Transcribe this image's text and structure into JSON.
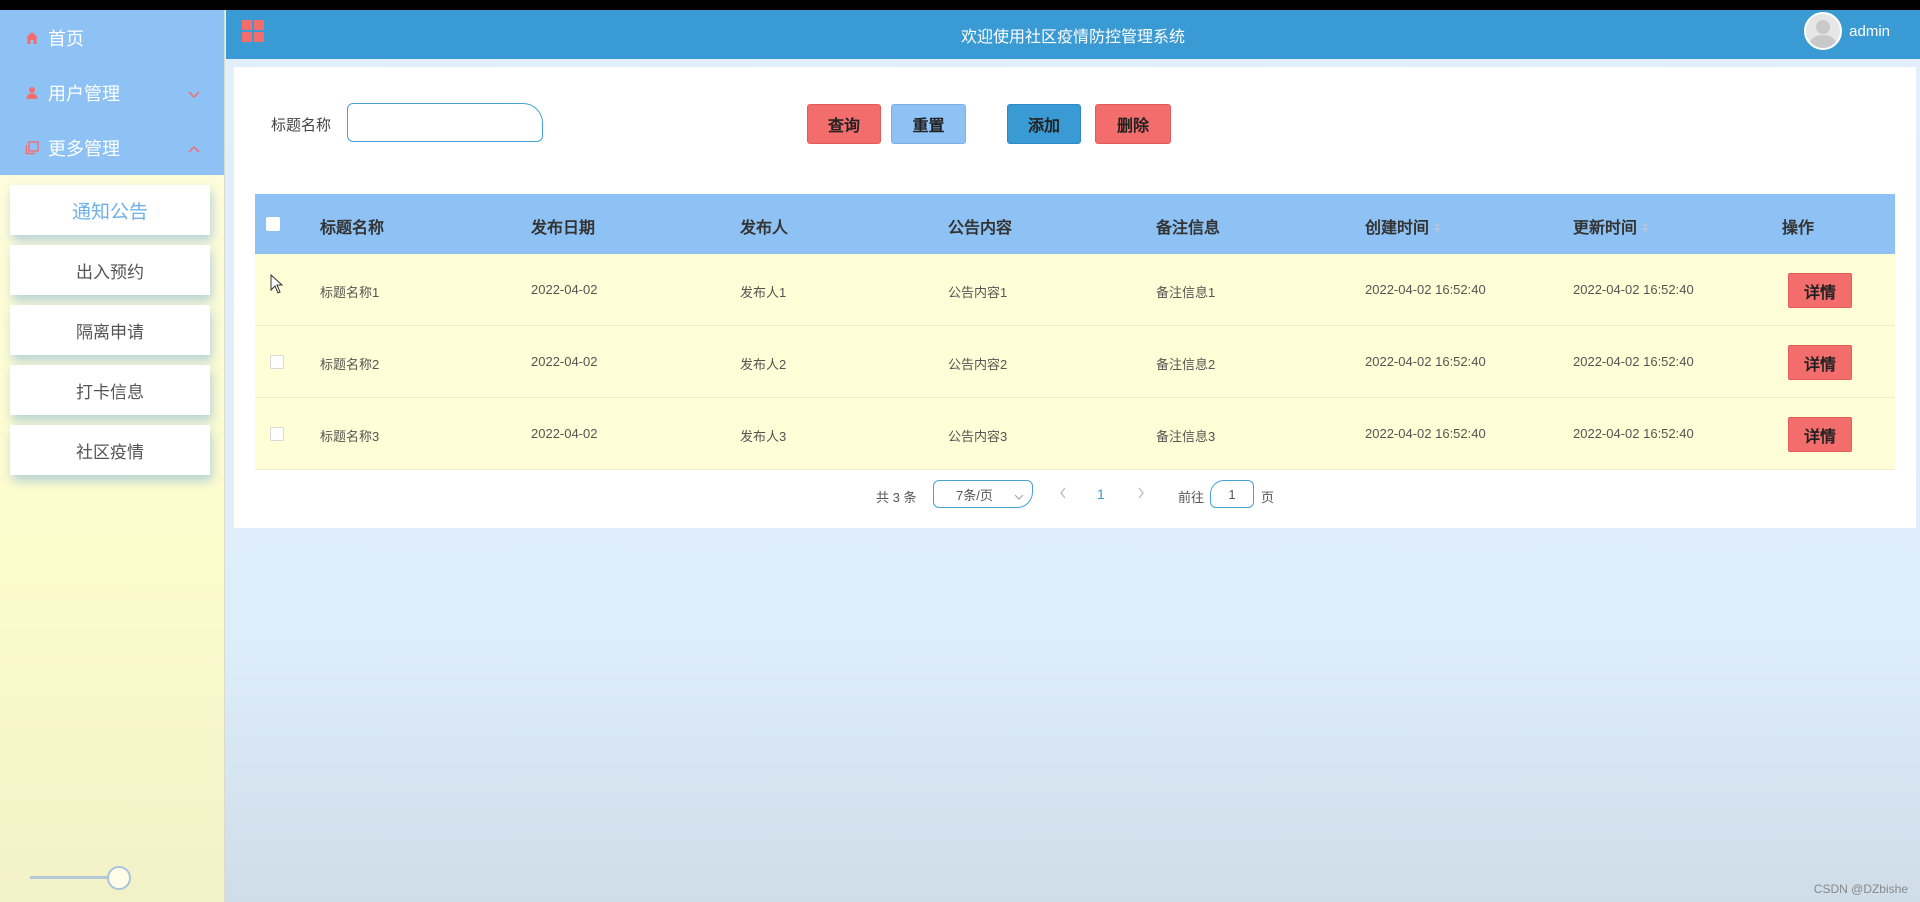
{
  "sidebar": {
    "home": "首页",
    "user_mgmt": "用户管理",
    "more_mgmt": "更多管理",
    "sub_items": [
      "通知公告",
      "出入预约",
      "隔离申请",
      "打卡信息",
      "社区疫情"
    ],
    "slider_value": 1.0
  },
  "header": {
    "title": "欢迎使用社区疫情防控管理系统",
    "username": "admin"
  },
  "search": {
    "label": "标题名称",
    "value": "",
    "placeholder": ""
  },
  "buttons": {
    "query": "查询",
    "reset": "重置",
    "add": "添加",
    "delete": "删除"
  },
  "table": {
    "columns": [
      "标题名称",
      "发布日期",
      "发布人",
      "公告内容",
      "备注信息",
      "创建时间",
      "更新时间",
      "操作"
    ],
    "rows": [
      [
        "标题名称1",
        "2022-04-02",
        "发布人1",
        "公告内容1",
        "备注信息1",
        "2022-04-02 16:52:40",
        "2022-04-02 16:52:40"
      ],
      [
        "标题名称2",
        "2022-04-02",
        "发布人2",
        "公告内容2",
        "备注信息2",
        "2022-04-02 16:52:40",
        "2022-04-02 16:52:40"
      ],
      [
        "标题名称3",
        "2022-04-02",
        "发布人3",
        "公告内容3",
        "备注信息3",
        "2022-04-02 16:52:40",
        "2022-04-02 16:52:40"
      ]
    ],
    "detail_label": "详情"
  },
  "pagination": {
    "total": "共 3 条",
    "page_size": "7条/页",
    "current_page": "1",
    "goto_label": "前往",
    "jump_value": "1",
    "unit": "页"
  },
  "watermark": "CSDN @DZbishe",
  "colors": {
    "header": "#3a9ad3",
    "menu_top": "#8ec2f5",
    "danger": "#f46d6d",
    "row_bg": "#fffed6"
  }
}
